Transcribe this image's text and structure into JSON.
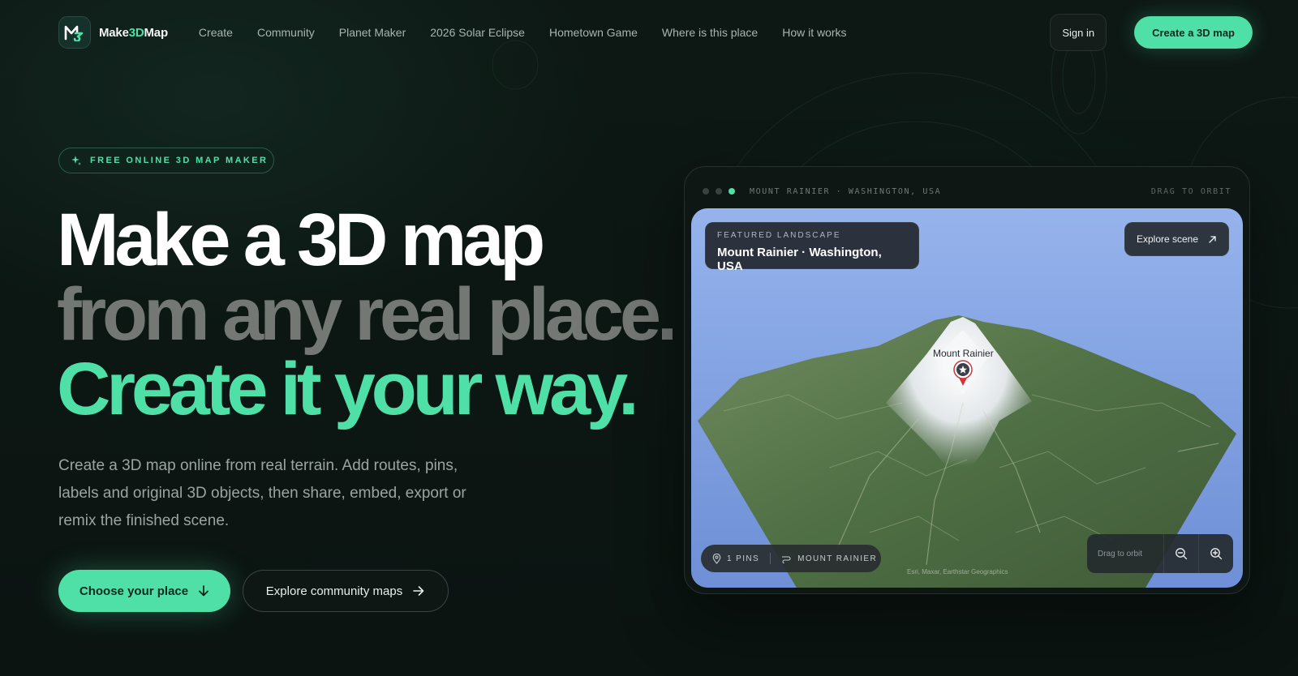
{
  "brand": {
    "name_prefix": "Make",
    "name_accent": "3D",
    "name_suffix": "Map",
    "accent_color": "#4fe0a8",
    "logo_icon": "m3-logo-icon"
  },
  "nav": {
    "links": [
      {
        "label": "Create"
      },
      {
        "label": "Community"
      },
      {
        "label": "Planet Maker"
      },
      {
        "label": "2026 Solar Eclipse"
      },
      {
        "label": "Hometown Game"
      },
      {
        "label": "Where is this place"
      },
      {
        "label": "How it works"
      }
    ],
    "sign_in": "Sign in",
    "cta": "Create a 3D map"
  },
  "hero": {
    "badge": "FREE ONLINE 3D MAP MAKER",
    "badge_icon": "sparkle-icon",
    "line1": "Make a 3D map",
    "line2": "from any real place.",
    "line3": "Create it your way.",
    "description": "Create a 3D map online from real terrain. Add routes, pins, labels and original 3D objects, then share, embed, export or remix the finished scene.",
    "primary_button": "Choose your place",
    "primary_icon": "arrow-down-icon",
    "secondary_button": "Explore community maps",
    "secondary_icon": "arrow-right-icon"
  },
  "preview": {
    "location": "MOUNT RAINIER · WASHINGTON, USA",
    "hint": "DRAG TO ORBIT",
    "featured_kicker": "FEATURED LANDSCAPE",
    "featured_title": "Mount Rainier · Washington, USA",
    "explore_button": "Explore scene",
    "explore_icon": "arrow-up-right-icon",
    "pin_label": "Mount Rainier",
    "pin_icon": "star-pin-icon",
    "pins": "1 PINS",
    "scene_name": "MOUNT RAINIER",
    "orbit_text": "Drag to orbit",
    "zoom_out_icon": "zoom-out-icon",
    "zoom_in_icon": "zoom-in-icon",
    "attribution": "Esri, Maxar, Earthstar Geographics"
  }
}
